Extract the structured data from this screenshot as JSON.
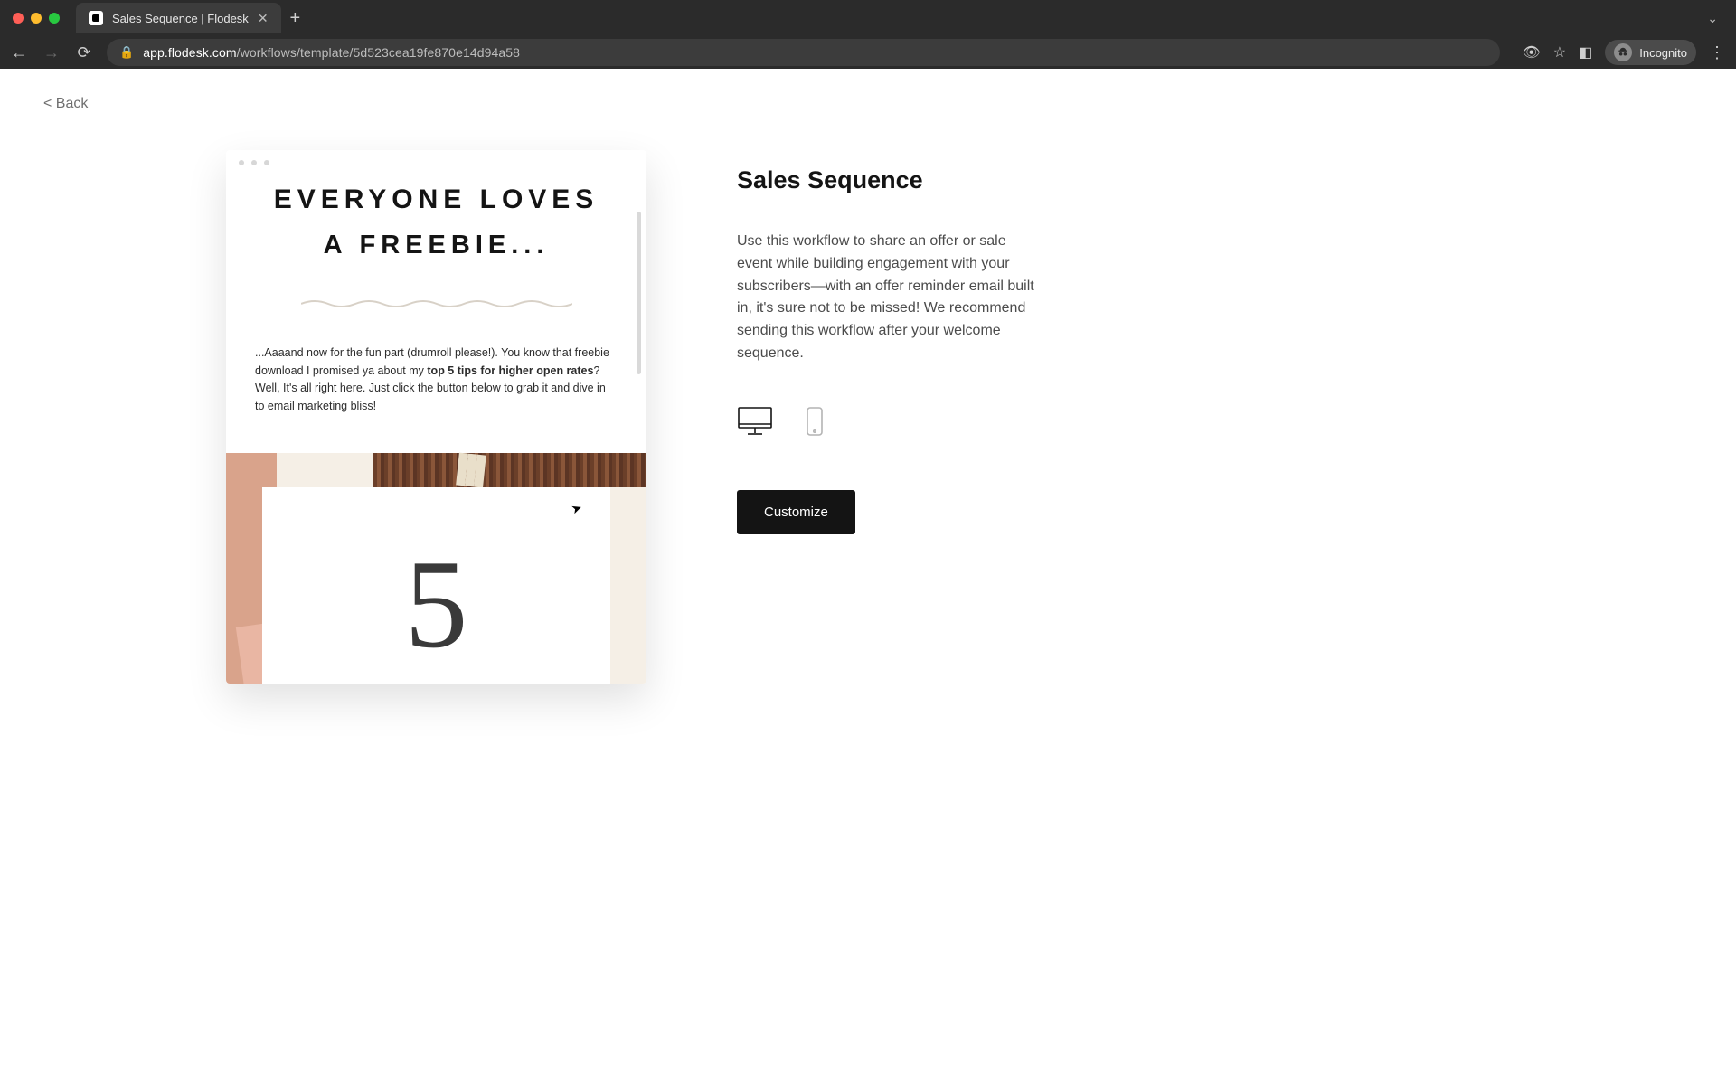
{
  "browser": {
    "tab_title": "Sales Sequence | Flodesk",
    "url_host": "app.flodesk.com",
    "url_path": "/workflows/template/5d523cea19fe870e14d94a58",
    "incognito_label": "Incognito"
  },
  "page": {
    "back_label": "< Back",
    "preview": {
      "headline_line1": "EVERYONE LOVES",
      "headline_line2": "A FREEBIE...",
      "para_pre": "...Aaaand now for the fun part (drumroll please!). You know that freebie download I promised ya about my ",
      "para_bold": "top 5 tips for higher open rates",
      "para_post": "? Well, It's all right here. Just click the button below to grab it and dive in to email marketing bliss!",
      "hero_number": "5"
    },
    "detail": {
      "title": "Sales Sequence",
      "description": "Use this workflow to share an offer or sale event while building engagement with your subscribers—with an offer reminder email built in, it's sure not to be missed! We recommend sending this workflow after your welcome sequence.",
      "customize_label": "Customize"
    }
  }
}
